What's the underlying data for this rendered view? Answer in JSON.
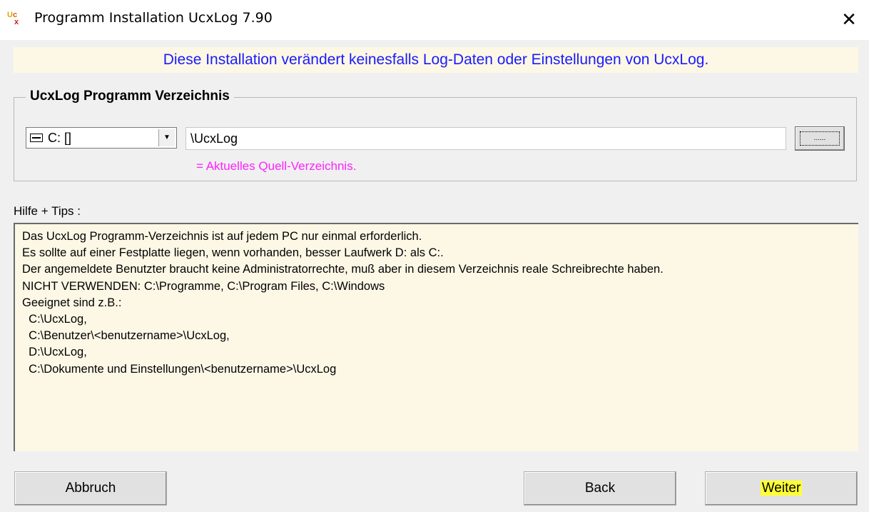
{
  "window": {
    "title": "Programm Installation UcxLog 7.90",
    "close_glyph": "✕",
    "app_icon": "ucxlog-logo-icon"
  },
  "banner": {
    "text": "Diese Installation verändert keinesfalls Log-Daten oder Einstellungen von UcxLog.",
    "color": "#1a1aff",
    "background": "#fdf8e6"
  },
  "directory_group": {
    "legend": "UcxLog Programm Verzeichnis",
    "drive_select": {
      "value": "C: []",
      "icon": "drive-icon"
    },
    "path_input": {
      "value": "\\UcxLog"
    },
    "browse_button": {
      "label": "......"
    },
    "source_note": {
      "text": "= Aktuelles Quell-Verzeichnis.",
      "color": "#ff22ff"
    }
  },
  "help": {
    "label": "Hilfe + Tips :",
    "lines": [
      "Das UcxLog Programm-Verzeichnis ist auf jedem PC nur einmal erforderlich.",
      "Es sollte auf einer Festplatte liegen, wenn vorhanden, besser Laufwerk D: als C:.",
      "Der angemeldete Benutzter braucht keine Administratorrechte, muß aber in diesem Verzeichnis reale Schreibrechte haben.",
      "NICHT VERWENDEN: C:\\Programme, C:\\Program Files, C:\\Windows",
      "Geeignet sind z.B.:",
      "  C:\\UcxLog,",
      "  C:\\Benutzer\\<benutzername>\\UcxLog,",
      "  D:\\UcxLog,",
      "  C:\\Dokumente und Einstellungen\\<benutzername>\\UcxLog"
    ],
    "background": "#fdf8e6"
  },
  "buttons": {
    "cancel": "Abbruch",
    "back": "Back",
    "next": "Weiter",
    "next_highlight": "#ffff33"
  }
}
